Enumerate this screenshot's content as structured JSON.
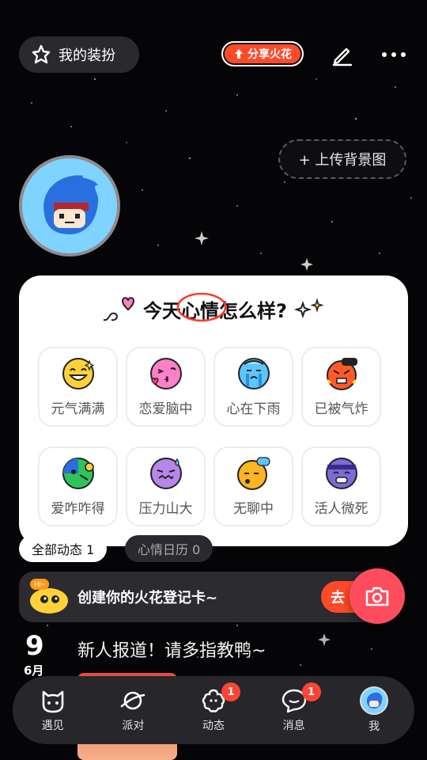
{
  "header": {
    "outfit_label": "我的装扮",
    "share_label": "分享火花"
  },
  "upload_bg_label": "+ 上传背景图",
  "mood": {
    "title_prefix": "今天",
    "title_highlight": "心情",
    "title_suffix": "怎么样?",
    "items": [
      {
        "label": "元气满满",
        "color": "#ffd23a"
      },
      {
        "label": "恋爱脑中",
        "color": "#ff7fc8"
      },
      {
        "label": "心在下雨",
        "color": "#5bc6ff"
      },
      {
        "label": "已被气炸",
        "color": "#ff5a2a"
      },
      {
        "label": "爱咋咋得",
        "color": "#2fc35b"
      },
      {
        "label": "压力山大",
        "color": "#b786e8"
      },
      {
        "label": "无聊中",
        "color": "#ffb422"
      },
      {
        "label": "活人微死",
        "color": "#7c6ad8"
      }
    ]
  },
  "tabs": {
    "all_label": "全部动态 1",
    "calendar_label": "心情日历 0"
  },
  "signin_card": {
    "mascot_text": "Hi~",
    "text": "创建你的火花登记卡~",
    "go_label": "去"
  },
  "post": {
    "day": "9",
    "month": "6月",
    "text": "新人报道！请多指教鸭~"
  },
  "nav": {
    "items": [
      {
        "label": "遇见"
      },
      {
        "label": "派对"
      },
      {
        "label": "动态",
        "badge": "1"
      },
      {
        "label": "消息",
        "badge": "1"
      },
      {
        "label": "我"
      }
    ]
  }
}
